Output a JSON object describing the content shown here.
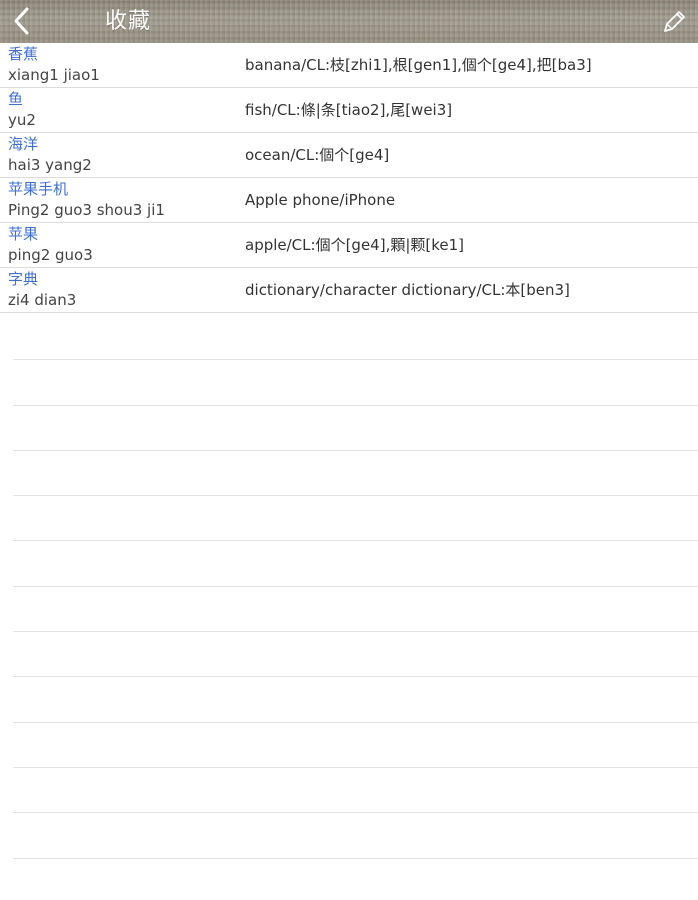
{
  "navbar": {
    "title": "收藏",
    "back_icon": "chevron-left-icon",
    "edit_icon": "pencil-icon"
  },
  "favorites": [
    {
      "hanzi": "香蕉",
      "pinyin": "xiang1 jiao1",
      "meaning": "banana/CL:枝[zhi1],根[gen1],個个[ge4],把[ba3]"
    },
    {
      "hanzi": "鱼",
      "pinyin": "yu2",
      "meaning": "fish/CL:條|条[tiao2],尾[wei3]"
    },
    {
      "hanzi": "海洋",
      "pinyin": "hai3 yang2",
      "meaning": "ocean/CL:個个[ge4]"
    },
    {
      "hanzi": "苹果手机",
      "pinyin": "Ping2 guo3 shou3 ji1",
      "meaning": "Apple phone/iPhone"
    },
    {
      "hanzi": "苹果",
      "pinyin": "ping2 guo3",
      "meaning": "apple/CL:個个[ge4],顆|颗[ke1]"
    },
    {
      "hanzi": "字典",
      "pinyin": "zi4 dian3",
      "meaning": "dictionary/character dictionary/CL:本[ben3]"
    }
  ],
  "colors": {
    "hanzi": "#3f6fd6",
    "pinyin": "#444444",
    "meaning": "#333333",
    "separator": "#dcdcdc"
  }
}
